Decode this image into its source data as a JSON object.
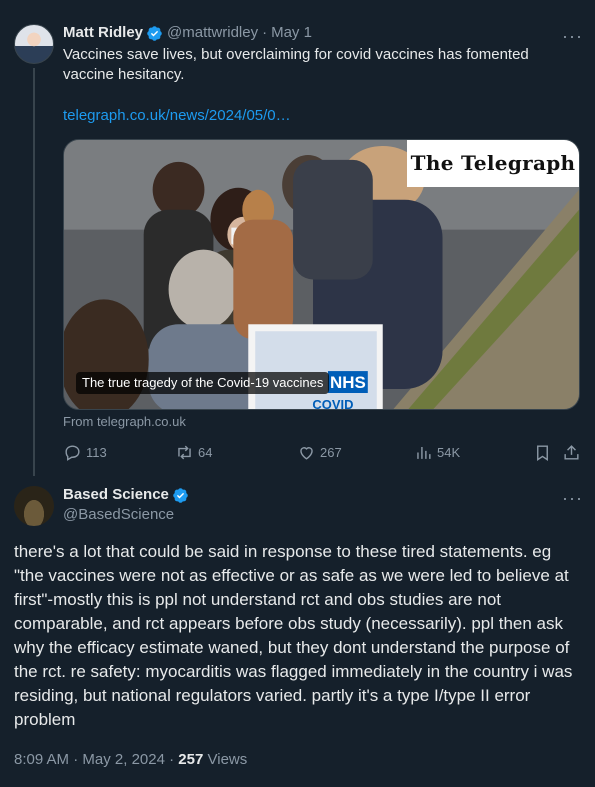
{
  "tweet1": {
    "author_name": "Matt Ridley",
    "handle": "@mattwridley",
    "separator": "·",
    "date": "May 1",
    "text": "Vaccines save lives, but overclaiming for covid vaccines has fomented vaccine hesitancy.",
    "link_text": "telegraph.co.uk/news/2024/05/0…",
    "card": {
      "publisher": "The Telegraph",
      "caption": "The true tragedy of the Covid-19 vaccines",
      "sign_text_1": "NHS",
      "sign_text_2": "COVID",
      "source": "From telegraph.co.uk"
    },
    "actions": {
      "replies": "113",
      "reposts": "64",
      "likes": "267",
      "views": "54K"
    }
  },
  "tweet2": {
    "author_name": "Based Science",
    "handle": "@BasedScience",
    "text": "there's a lot that could be said in response to these tired statements. eg \"the vaccines were not as effective or as safe as we were led to believe at first\"-mostly this is ppl not understand rct and obs studies are not comparable, and rct appears before obs study (necessarily). ppl then ask why the efficacy estimate waned, but they dont understand the purpose of the rct. re safety: myocarditis was flagged immediately in the country i was residing, but national regulators varied. partly it's a type I/type II error problem",
    "time": "8:09 AM",
    "separator": "·",
    "date": "May 2, 2024",
    "separator2": "·",
    "views_count": "257",
    "views_label": "Views"
  },
  "more_glyph": "···",
  "colors": {
    "background": "#15202b",
    "text": "#e7e9ea",
    "muted": "#8b98a5",
    "link": "#1d9bf0",
    "verified": "#1d9bf0"
  }
}
